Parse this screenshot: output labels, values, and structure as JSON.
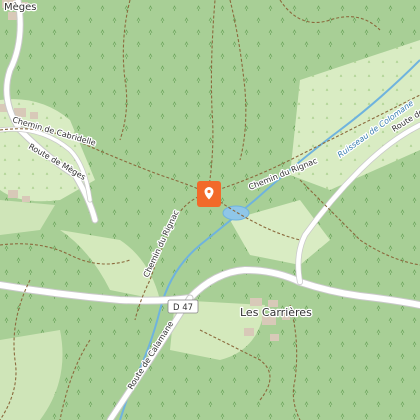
{
  "map": {
    "colors": {
      "forest": "#a8cf96",
      "meadow": "#d9ecc3",
      "road": "#ffffff",
      "road_casing": "#c9c9c9",
      "track": "#8b6a3d",
      "water": "#6fb3de",
      "marker": "#f26a2a"
    },
    "labels": {
      "meges": "Mèges",
      "chemin_cabridelle": "Chemin de Cabridelle",
      "route_meges": "Route de Mèges",
      "chemin_rignac_top": "Chemin du Rignac",
      "chemin_rignac_left": "Chemin du Rignac",
      "ruisseau": "Ruisseau de Colomane",
      "route_right": "Route de",
      "les_carrieres": "Les Carrières",
      "route_calamane": "Route de Calamane",
      "d47": "D 47"
    },
    "marker": {
      "icon": "map-pin-icon"
    }
  }
}
